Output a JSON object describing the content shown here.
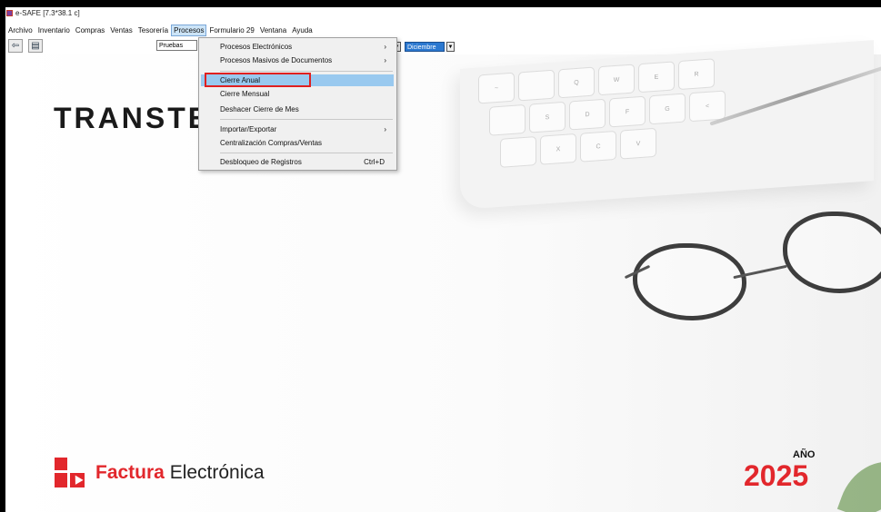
{
  "window": {
    "title": "e-SAFE [7.3*38.1 c]"
  },
  "menubar": {
    "items": [
      "Archivo",
      "Inventario",
      "Compras",
      "Ventas",
      "Tesorería",
      "Procesos",
      "Formulario 29",
      "Ventana",
      "Ayuda"
    ],
    "active": "Procesos"
  },
  "toolbar": {
    "company_value": "Pruebas",
    "month_value": "Diciembre"
  },
  "procesos_menu": {
    "items": [
      {
        "label": "Procesos Electrónicos",
        "submenu": "›"
      },
      {
        "label": "Procesos Masivos de Documentos",
        "submenu": "›"
      },
      {
        "label": "Cierre Anual"
      },
      {
        "label": "Cierre Mensual"
      },
      {
        "label": "Deshacer Cierre de Mes"
      },
      {
        "label": "Importar/Exportar",
        "submenu": "›"
      },
      {
        "label": "Centralización Compras/Ventas"
      },
      {
        "label": "Desbloqueo de Registros",
        "shortcut": "Ctrl+D"
      }
    ],
    "highlighted_item": "Cierre Anual",
    "highlight_color": "#99c9ef",
    "annotation_color": "#e02020"
  },
  "branding": {
    "company_text": "TRANST",
    "company_text_tail": "E",
    "logo_bold": "Factura",
    "logo_regular": " Electrónica",
    "year_label": "AÑO",
    "year_value": "2025",
    "accent_color": "#e2272c"
  },
  "keyboard_keys": [
    "~",
    "",
    "Q",
    "W",
    "E",
    "R",
    "",
    "S",
    "D",
    "F",
    "G",
    "<",
    "",
    "X",
    "C",
    "V"
  ]
}
